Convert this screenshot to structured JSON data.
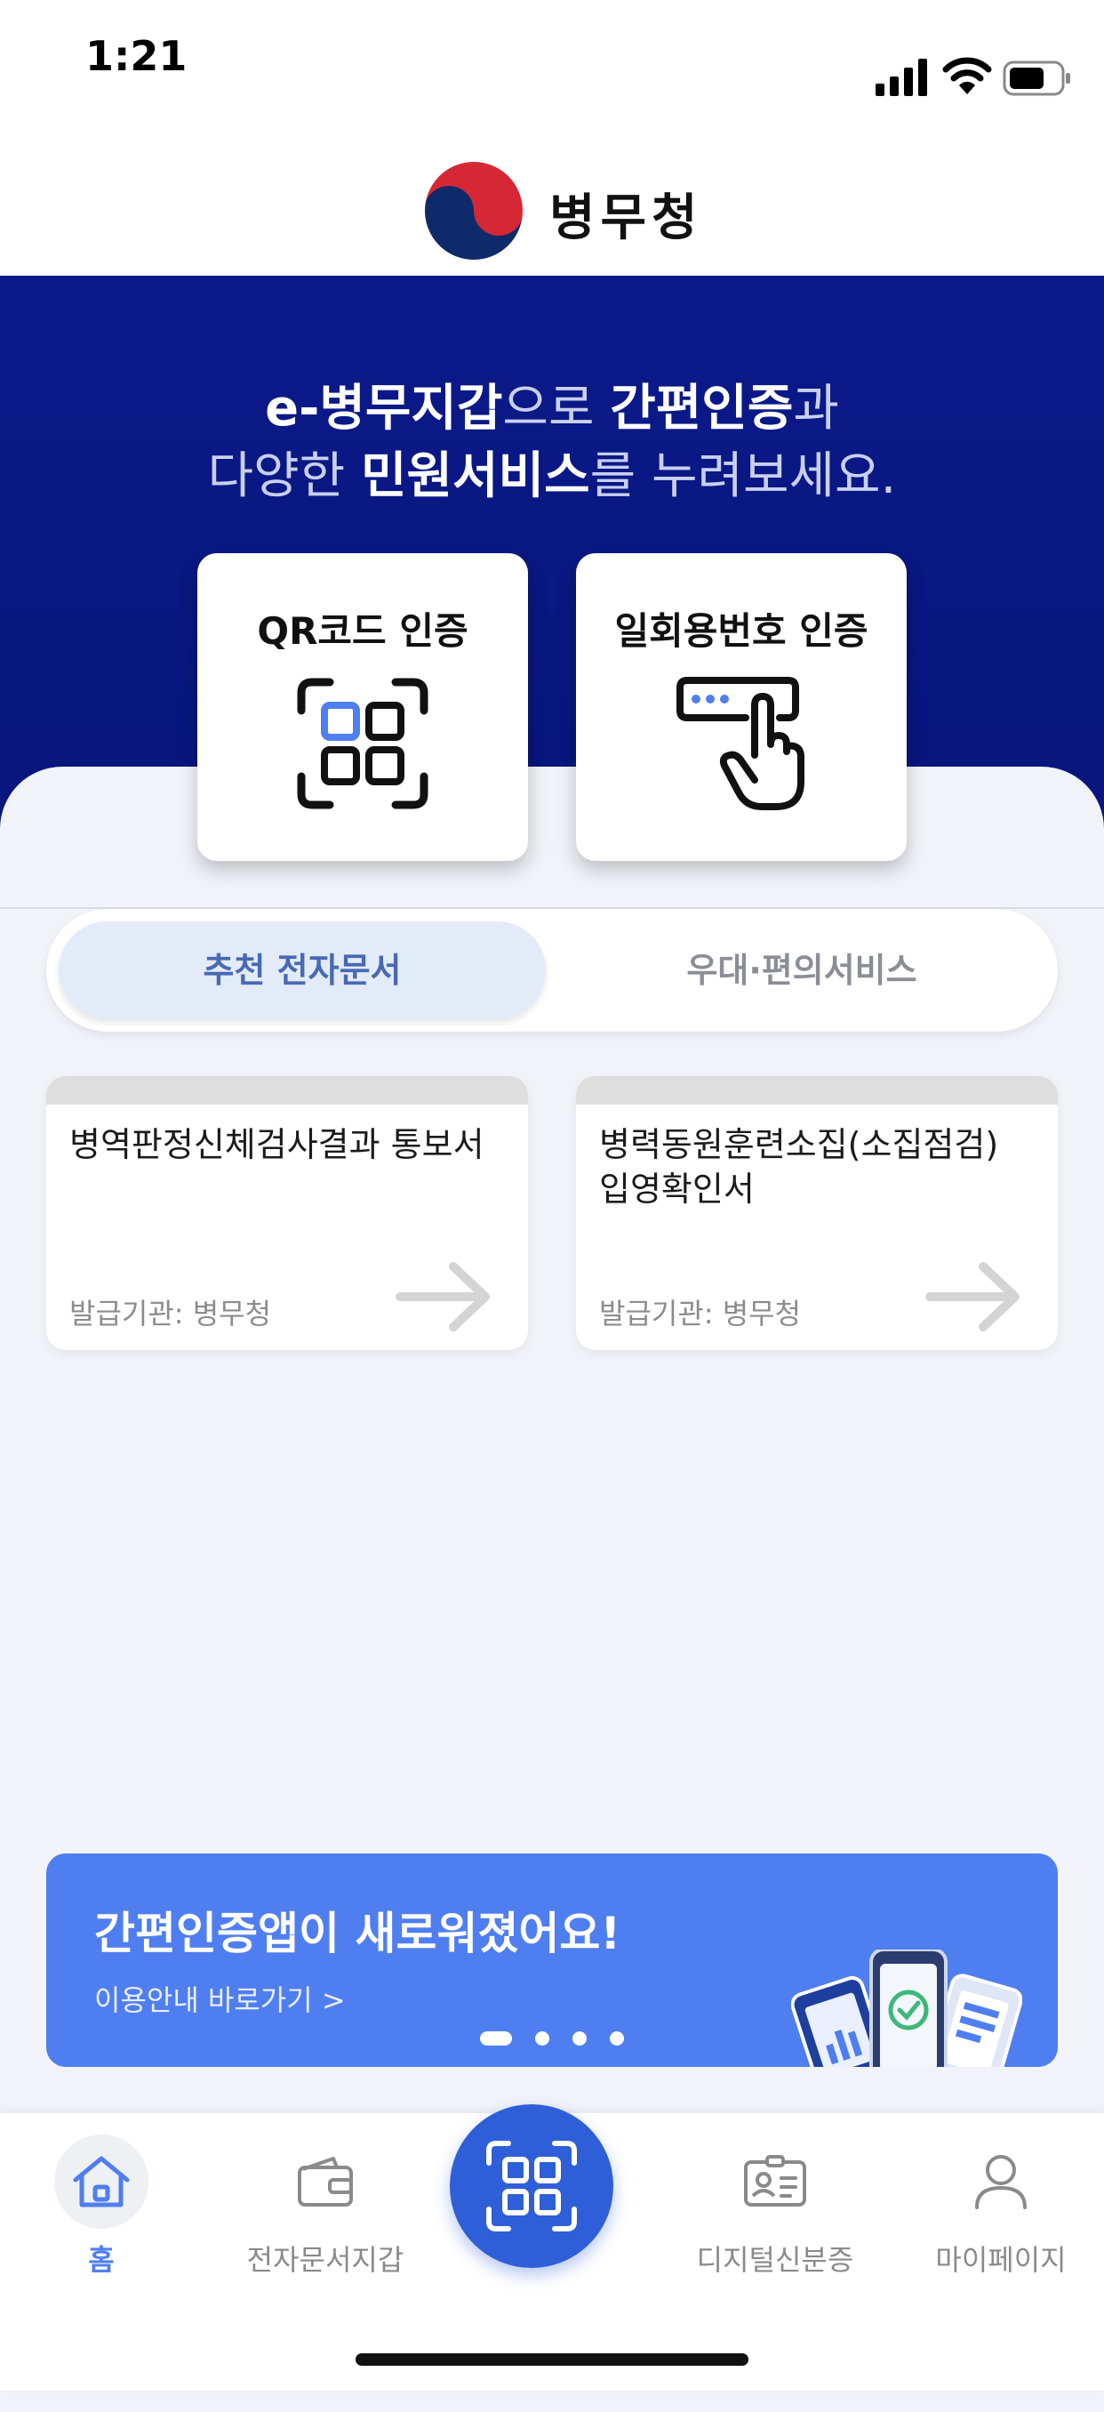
{
  "status_bar": {
    "time": "1:21"
  },
  "header": {
    "logo_text": "병무청"
  },
  "hero": {
    "line1": [
      {
        "text": "e-병무지갑",
        "bold": true
      },
      {
        "text": "으로 ",
        "bold": false
      },
      {
        "text": "간편인증",
        "bold": true
      },
      {
        "text": "과",
        "bold": false
      }
    ],
    "line2": [
      {
        "text": "다양한 ",
        "bold": false
      },
      {
        "text": "민원서비스",
        "bold": true
      },
      {
        "text": "를 누려보세요.",
        "bold": false
      }
    ]
  },
  "auth_cards": {
    "qr": {
      "label": "QR코드 인증",
      "icon": "qr-scan-icon"
    },
    "otp": {
      "label": "일회용번호 인증",
      "icon": "touch-keypad-icon"
    }
  },
  "tabs": {
    "recommended": "추천 전자문서",
    "benefits": "우대·편의서비스",
    "active": "recommended"
  },
  "documents": [
    {
      "name": "병역판정신체검사결과 통보서",
      "issuer": "발급기관: 병무청"
    },
    {
      "name": "병력동원훈련소집(소집점검) 입영확인서",
      "issuer": "발급기관: 병무청"
    }
  ],
  "banner": {
    "title": "간편인증앱이 새로워졌어요!",
    "link": "이용안내 바로가기 >",
    "page_count": 4,
    "active_page": 1
  },
  "tab_bar": {
    "home": "홈",
    "wallet": "전자문서지갑",
    "digital_id": "디지털신분증",
    "mypage": "마이페이지",
    "center_icon": "qr-code-icon"
  },
  "colors": {
    "hero_navy": "#0b1a8a",
    "accent_blue": "#4f7ef0",
    "fab_blue": "#2f5fd8",
    "tab_active_text": "#4869b4"
  }
}
